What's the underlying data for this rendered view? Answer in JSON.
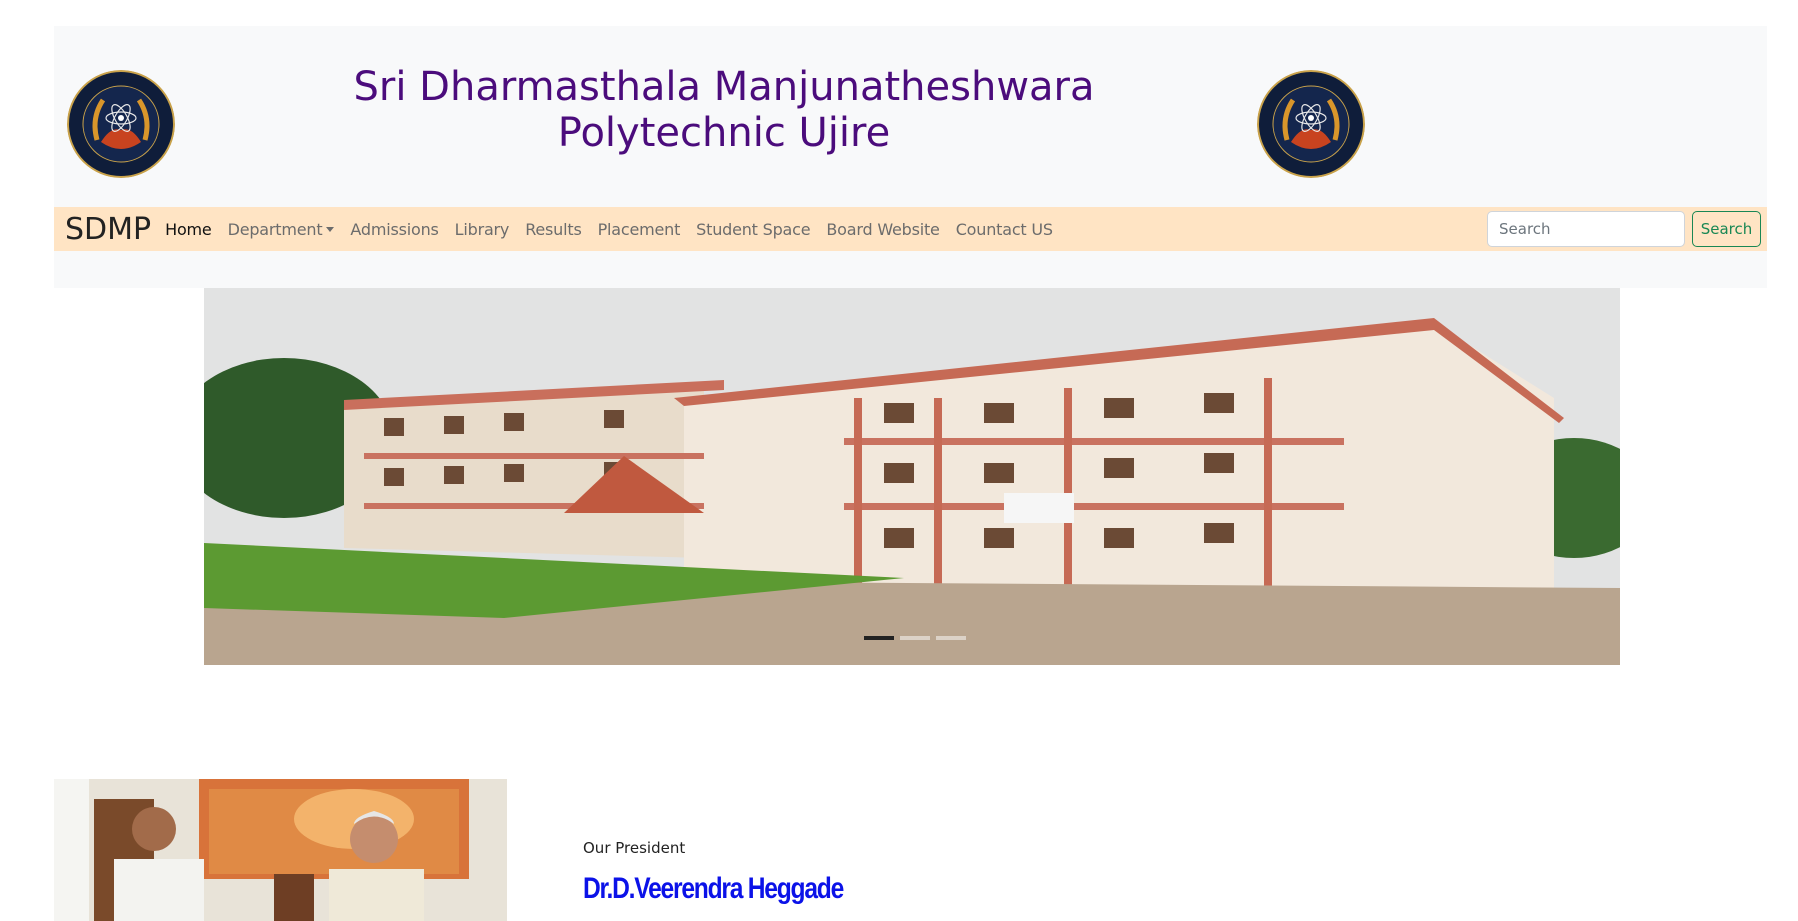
{
  "header": {
    "title_line1": "Sri Dharmasthala Manjunatheshwara",
    "title_line2": "Polytechnic Ujire"
  },
  "navbar": {
    "brand": "SDMP",
    "items": [
      {
        "label": "Home",
        "active": true
      },
      {
        "label": "Department",
        "dropdown": true
      },
      {
        "label": "Admissions"
      },
      {
        "label": "Library"
      },
      {
        "label": "Results"
      },
      {
        "label": "Placement"
      },
      {
        "label": "Student Space"
      },
      {
        "label": "Board Website"
      },
      {
        "label": "Countact US"
      }
    ],
    "search_placeholder": "Search",
    "search_button": "Search"
  },
  "president": {
    "label": "Our President",
    "name": "Dr.D.Veerendra Heggade"
  },
  "colors": {
    "title": "#4b0c7c",
    "navbar_bg": "#ffe4c4",
    "search_button": "#198754",
    "president_name": "#0b12e8"
  }
}
